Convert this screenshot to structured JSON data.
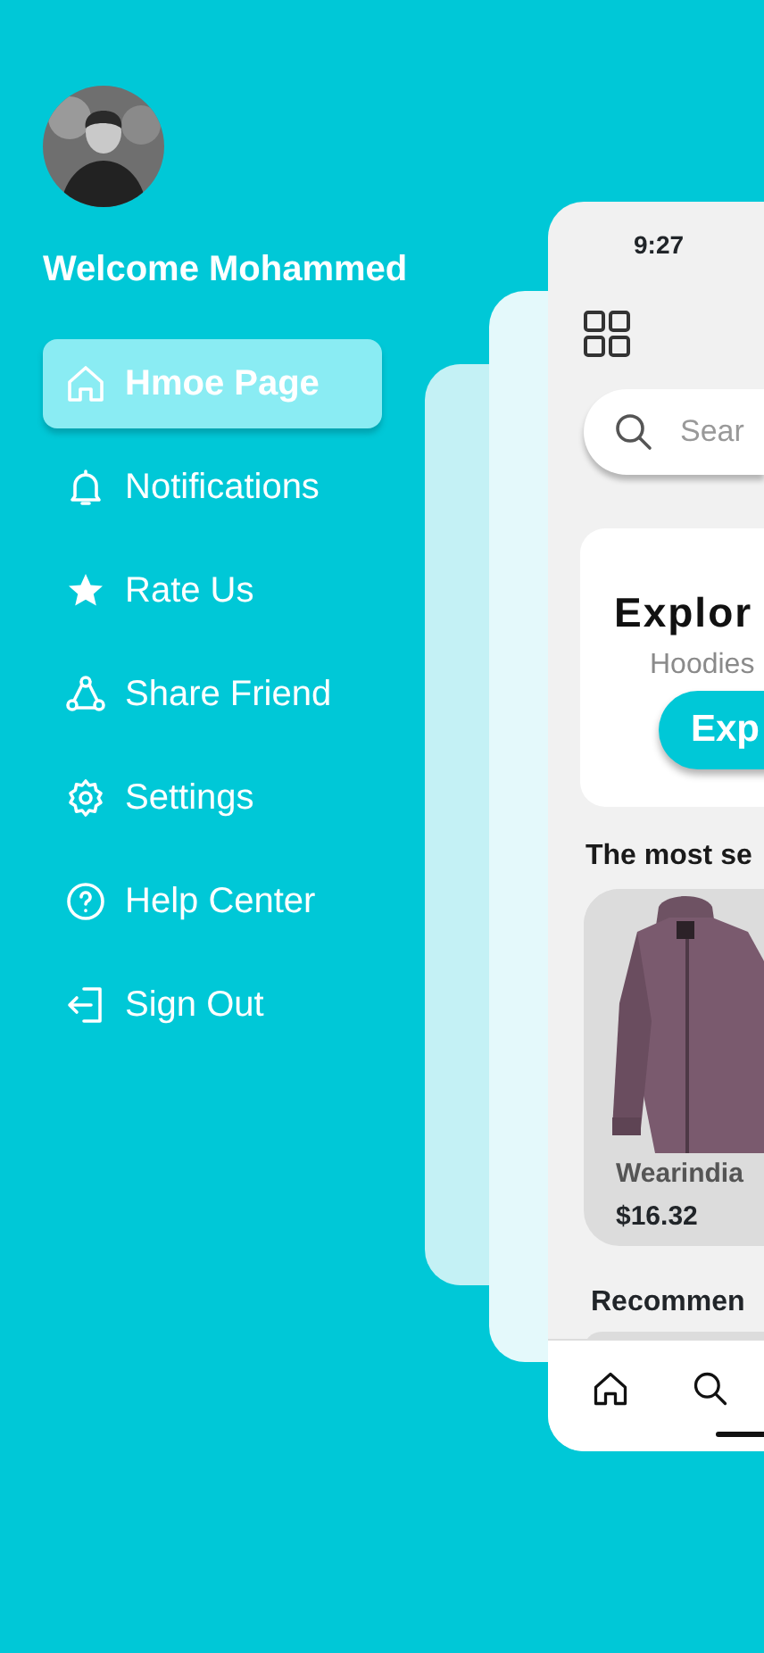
{
  "profile": {
    "greeting": "Welcome Mohammed"
  },
  "menu": [
    {
      "kind": "home",
      "label": "Hmoe Page",
      "selected": true
    },
    {
      "kind": "bell",
      "label": "Notifications",
      "selected": false
    },
    {
      "kind": "star",
      "label": "Rate Us",
      "selected": false
    },
    {
      "kind": "share",
      "label": "Share Friend",
      "selected": false
    },
    {
      "kind": "gear",
      "label": "Settings",
      "selected": false
    },
    {
      "kind": "help",
      "label": "Help Center",
      "selected": false
    },
    {
      "kind": "signout",
      "label": "Sign Out",
      "selected": false
    }
  ],
  "phone": {
    "status_time": "9:27",
    "search": {
      "placeholder": "Sear"
    },
    "banner": {
      "title": "Explor",
      "subtitle": "Hoodies",
      "button": "Exp"
    },
    "section_title": "The most se",
    "products": [
      {
        "name": "Wearindia",
        "price": "$16.32"
      }
    ],
    "section_title_2": "Recommen",
    "bottom_nav": [
      {
        "kind": "home"
      },
      {
        "kind": "search"
      }
    ]
  }
}
